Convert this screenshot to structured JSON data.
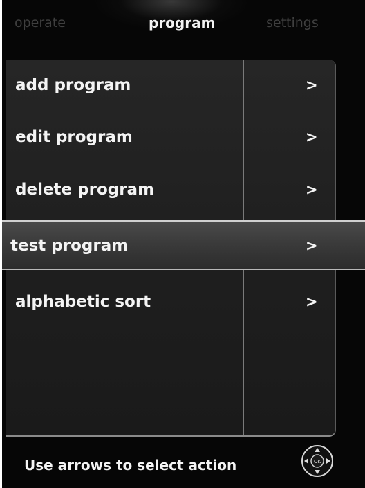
{
  "tabs": {
    "operate": "operate",
    "program": "program",
    "settings": "settings"
  },
  "menu": {
    "items": [
      {
        "label": "add program",
        "chevron": ">"
      },
      {
        "label": "edit program",
        "chevron": ">"
      },
      {
        "label": "delete program",
        "chevron": ">"
      },
      {
        "label": "test program",
        "chevron": ">"
      },
      {
        "label": "alphabetic sort",
        "chevron": ">"
      }
    ],
    "selected_index": 3
  },
  "footer": {
    "instruction": "Use arrows to select action",
    "dpad_center_label": "OK"
  },
  "colors": {
    "background": "#060606",
    "active_text": "#f2f2f2",
    "inactive_tab": "#3f3f3f"
  }
}
